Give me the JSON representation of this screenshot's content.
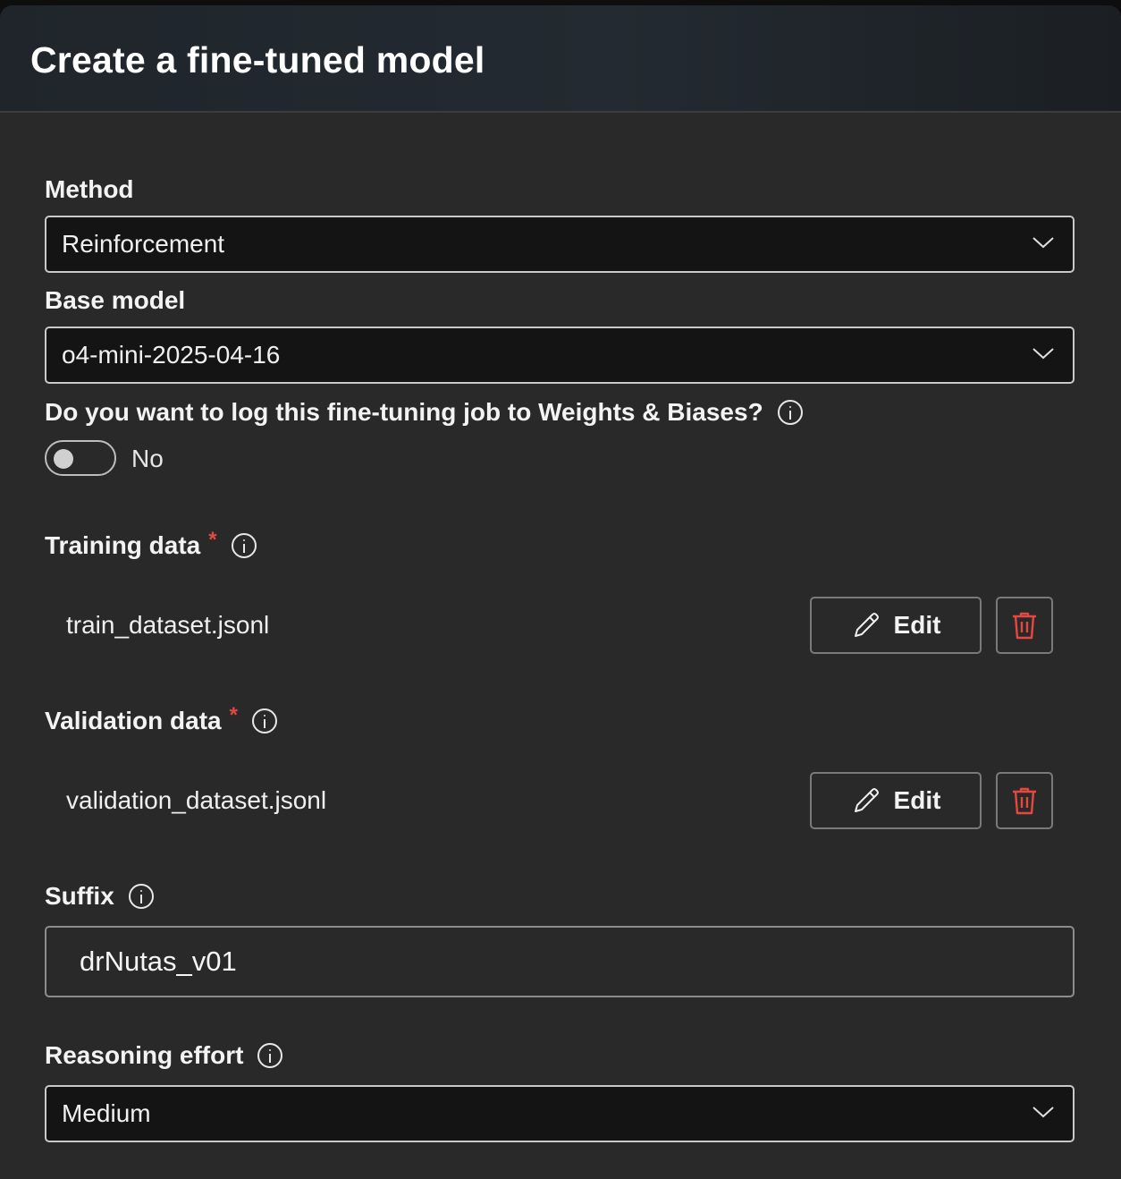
{
  "dialog": {
    "title": "Create a fine-tuned model"
  },
  "method": {
    "label": "Method",
    "value": "Reinforcement"
  },
  "base_model": {
    "label": "Base model",
    "value": "o4-mini-2025-04-16"
  },
  "wandb": {
    "question": "Do you want to log this fine-tuning job to Weights & Biases?",
    "toggle_state": "No"
  },
  "training_data": {
    "label": "Training data",
    "required_mark": "*",
    "file": "train_dataset.jsonl",
    "edit_label": "Edit"
  },
  "validation_data": {
    "label": "Validation data",
    "required_mark": "*",
    "file": "validation_dataset.jsonl",
    "edit_label": "Edit"
  },
  "suffix": {
    "label": "Suffix",
    "value": "drNutas_v01"
  },
  "reasoning_effort": {
    "label": "Reasoning effort",
    "value": "Medium"
  },
  "colors": {
    "panel_bg": "#292929",
    "required": "#e5483f",
    "delete_icon": "#e5483f"
  }
}
